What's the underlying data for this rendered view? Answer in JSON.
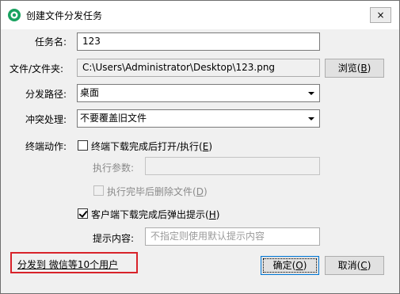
{
  "window": {
    "title": "创建文件分发任务",
    "close_label": "×",
    "icon": "app-logo-icon",
    "accent": "#1aa260"
  },
  "form": {
    "task_name_label": "任务名:",
    "task_name_value": "123",
    "file_label": "文件/文件夹:",
    "file_value": "C:\\Users\\Administrator\\Desktop\\123.png",
    "browse_label": "浏览(",
    "browse_key": "B",
    "browse_close": ")",
    "path_label": "分发路径:",
    "path_value": "桌面",
    "conflict_label": "冲突处理:",
    "conflict_value": "不要覆盖旧文件",
    "terminal_action_label": "终端动作:",
    "open_after_label": "终端下载完成后打开/执行(",
    "open_after_key": "E",
    "open_after_close": ")",
    "open_after_checked": false,
    "exec_params_label": "执行参数:",
    "exec_params_value": "",
    "delete_after_label": "执行完毕后删除文件(",
    "delete_after_key": "D",
    "delete_after_close": ")",
    "delete_after_checked": false,
    "client_popup_label": "客户端下载完成后弹出提示(",
    "client_popup_key": "H",
    "client_popup_close": ")",
    "client_popup_checked": true,
    "prompt_label": "提示内容:",
    "prompt_placeholder": "不指定则使用默认提示内容"
  },
  "footer": {
    "distribute_link": "分发到 微信等10个用户",
    "ok_label": "确定(",
    "ok_key": "O",
    "ok_close": ")",
    "cancel_label": "取消(",
    "cancel_key": "C",
    "cancel_close": ")",
    "highlight_color": "#d8232a"
  }
}
